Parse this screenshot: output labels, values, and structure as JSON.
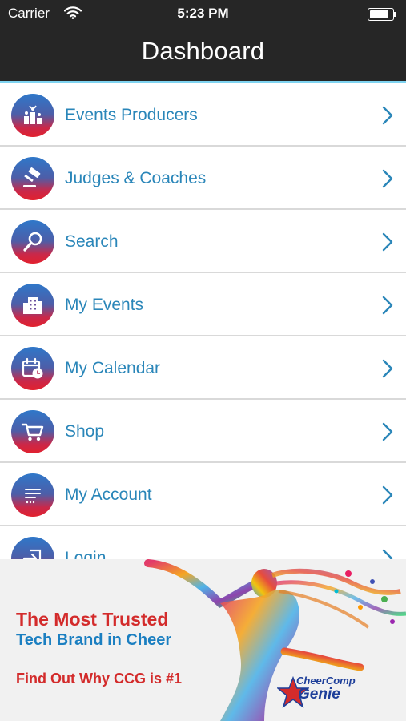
{
  "status_bar": {
    "carrier": "Carrier",
    "time": "5:23 PM",
    "battery_level": 0.85
  },
  "nav": {
    "title": "Dashboard"
  },
  "menu": {
    "items": [
      {
        "label": "Events Producers",
        "icon": "podium-icon"
      },
      {
        "label": "Judges & Coaches",
        "icon": "gavel-icon"
      },
      {
        "label": "Search",
        "icon": "magnifier-icon"
      },
      {
        "label": "My Events",
        "icon": "building-icon"
      },
      {
        "label": "My Calendar",
        "icon": "calendar-clock-icon"
      },
      {
        "label": "Shop",
        "icon": "cart-icon"
      },
      {
        "label": "My Account",
        "icon": "list-icon"
      },
      {
        "label": "Login",
        "icon": "login-icon"
      }
    ]
  },
  "ad_banner": {
    "line1": "The Most Trusted",
    "line2": "Tech Brand in Cheer",
    "line3": "Find Out Why CCG is #1",
    "logo_top": "CheerComp",
    "logo_bottom": "Genie"
  },
  "colors": {
    "header_bg": "#262626",
    "accent_line": "#7fd3f0",
    "label_blue": "#2a86b9",
    "ad_red": "#d32b2b",
    "ad_blue": "#1b7fc1"
  }
}
